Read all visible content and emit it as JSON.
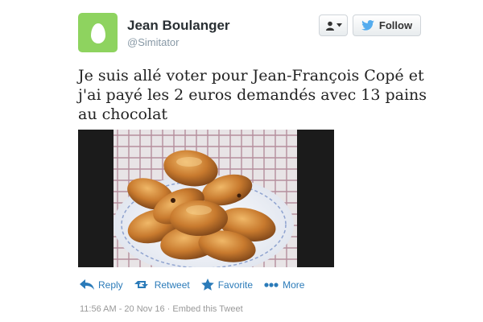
{
  "user": {
    "display_name": "Jean Boulanger",
    "screen_name": "@Simitator",
    "avatar_color": "#8ed35f",
    "avatar_icon": "egg-icon"
  },
  "header": {
    "user_dropdown_icon": "user-dropdown-icon",
    "follow_label": "Follow",
    "follow_icon": "twitter-bird-icon"
  },
  "tweet": {
    "text": "Je suis allé voter pour Jean-François Copé et j'ai payé les 2 euros demandés avec 13 pains au chocolat",
    "media_description_icon": "pains-au-chocolat-photo"
  },
  "actions": [
    {
      "label": "Reply",
      "icon": "reply-icon"
    },
    {
      "label": "Retweet",
      "icon": "retweet-icon"
    },
    {
      "label": "Favorite",
      "icon": "star-icon"
    },
    {
      "label": "More",
      "icon": "more-dots-icon"
    }
  ],
  "meta": {
    "timestamp": "11:56 AM - 20 Nov 16",
    "separator": "·",
    "embed_label": "Embed this Tweet"
  },
  "colors": {
    "link": "#2b7bb9",
    "twitter_blue": "#55acee",
    "meta_gray": "#999999"
  }
}
